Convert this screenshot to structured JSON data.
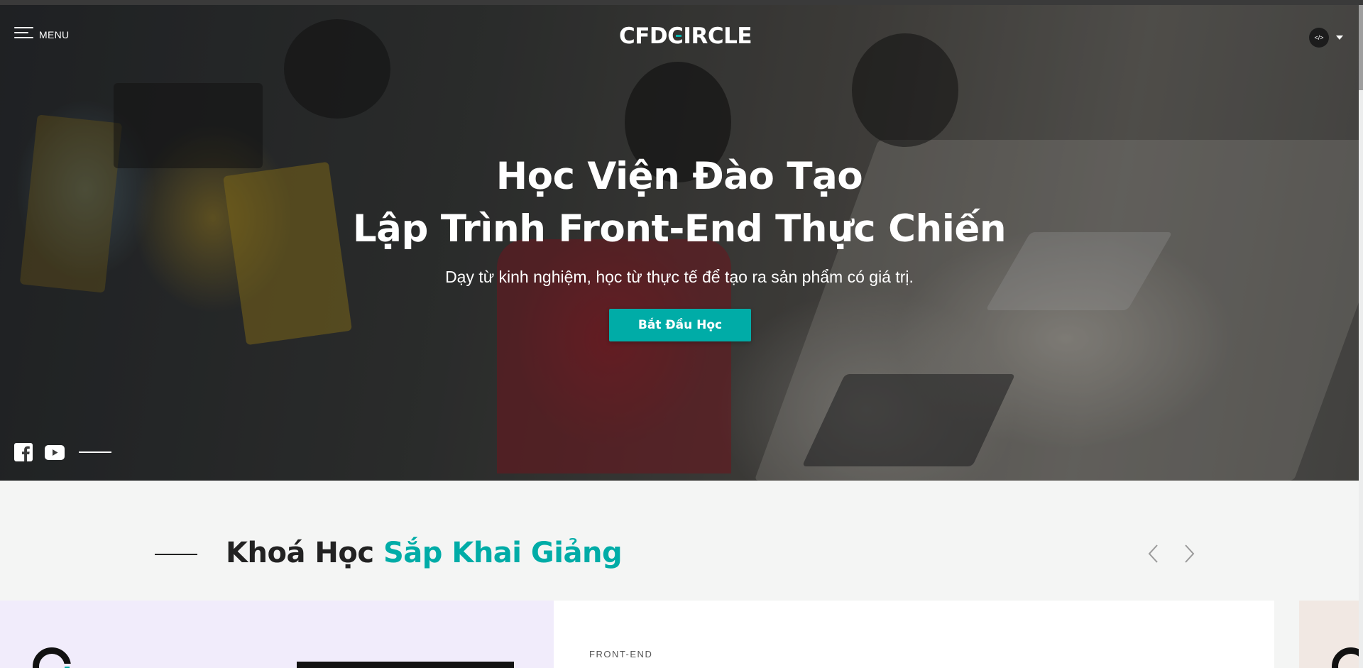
{
  "header": {
    "menu_label": "MENU",
    "logo_text": "CFDCIRCLE",
    "avatar_text": "</>"
  },
  "hero": {
    "title_line1": "Học Viện Đào Tạo",
    "title_line2": "Lập Trình Front-End Thực Chiến",
    "subtitle": "Dạy từ kinh nghiệm, học từ thực tế để tạo ra sản phẩm có giá trị.",
    "cta_label": "Bắt Đầu Học",
    "social_icons": [
      "facebook-icon",
      "youtube-icon"
    ]
  },
  "section": {
    "title_main": "Khoá Học ",
    "title_accent": "Sắp Khai Giảng",
    "prev_icon": "chevron-left-icon",
    "next_icon": "chevron-right-icon"
  },
  "courses": [
    {
      "category": "FRONT-END"
    }
  ],
  "colors": {
    "accent": "#00aca7",
    "dark_text": "#222222",
    "section_bg": "#f4f5f4",
    "card_left_bg": "#f1ecfb",
    "card_right_bg": "#f1e8e3"
  }
}
